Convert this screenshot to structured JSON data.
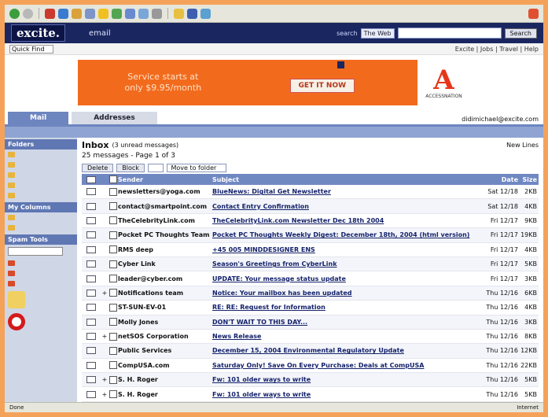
{
  "header": {
    "logo": "excite.",
    "section": "email",
    "search_label": "search",
    "search_scope": "The Web",
    "search_button": "Search"
  },
  "util": {
    "quick_find": "Quick Find",
    "links": "Excite | Jobs | Travel | Help"
  },
  "ad": {
    "line1": "Service starts at",
    "line2": "only $9.95/month",
    "cta": "GET IT NOW",
    "brand_name": "ACCESSNATION"
  },
  "tabs": [
    {
      "label": "Mail"
    },
    {
      "label": "Addresses"
    }
  ],
  "user_email": "didimichael@excite.com",
  "sidebar": {
    "folders_head": "Folders",
    "mycolumns_head": "My Columns",
    "spam_head": "Spam Tools"
  },
  "inbox": {
    "title": "Inbox",
    "subtitle": "(3 unread messages)",
    "count": "25 messages - Page 1 of 3",
    "new_label": "New Lines",
    "buttons": [
      "Delete",
      "Block"
    ],
    "move_select": "Move to folder"
  },
  "columns": {
    "from": "Sender",
    "subject": "Subject",
    "date": "Date",
    "size": "Size"
  },
  "messages": [
    {
      "from": "newsletters@yoga.com",
      "subject": "BlueNews: Digital Get Newsletter",
      "date": "Sat 12/18",
      "size": "2KB",
      "thread": false
    },
    {
      "from": "contact@smartpoint.com",
      "subject": "Contact Entry Confirmation",
      "date": "Sat 12/18",
      "size": "4KB",
      "thread": false
    },
    {
      "from": "TheCelebrityLink.com",
      "subject": "TheCelebrityLink.com Newsletter Dec 18th 2004",
      "date": "Fri 12/17",
      "size": "9KB",
      "thread": false
    },
    {
      "from": "Pocket PC Thoughts Team",
      "subject": "Pocket PC Thoughts Weekly Digest: December 18th, 2004 (html version)",
      "date": "Fri 12/17",
      "size": "19KB",
      "thread": false
    },
    {
      "from": "RMS deep",
      "subject": "+45 005 MINDDESIGNER ENS",
      "date": "Fri 12/17",
      "size": "4KB",
      "thread": false
    },
    {
      "from": "Cyber Link",
      "subject": "Season's Greetings from CyberLink",
      "date": "Fri 12/17",
      "size": "5KB",
      "thread": false
    },
    {
      "from": "leader@cyber.com",
      "subject": "UPDATE: Your message status update",
      "date": "Fri 12/17",
      "size": "3KB",
      "thread": false
    },
    {
      "from": "Notifications team",
      "subject": "Notice: Your mailbox has been updated",
      "date": "Thu 12/16",
      "size": "6KB",
      "thread": true
    },
    {
      "from": "ST-SUN-EV-01",
      "subject": "RE: RE: Request for Information",
      "date": "Thu 12/16",
      "size": "4KB",
      "thread": false
    },
    {
      "from": "Molly Jones",
      "subject": "DON'T WAIT TO THIS DAY...",
      "date": "Thu 12/16",
      "size": "3KB",
      "thread": false
    },
    {
      "from": "netSOS Corporation",
      "subject": "News Release",
      "date": "Thu 12/16",
      "size": "8KB",
      "thread": true
    },
    {
      "from": "Public Services",
      "subject": "December 15, 2004 Environmental Regulatory Update",
      "date": "Thu 12/16",
      "size": "12KB",
      "thread": false
    },
    {
      "from": "CompUSA.com",
      "subject": "Saturday Only! Save On Every Purchase: Deals at CompUSA",
      "date": "Thu 12/16",
      "size": "22KB",
      "thread": false
    },
    {
      "from": "S. H. Roger",
      "subject": "Fw: 101 older ways to write",
      "date": "Thu 12/16",
      "size": "5KB",
      "thread": true
    },
    {
      "from": "S. H. Roger",
      "subject": "Fw: 101 older ways to write",
      "date": "Thu 12/16",
      "size": "5KB",
      "thread": true
    }
  ],
  "status": {
    "left": "Done",
    "right": "Internet"
  }
}
